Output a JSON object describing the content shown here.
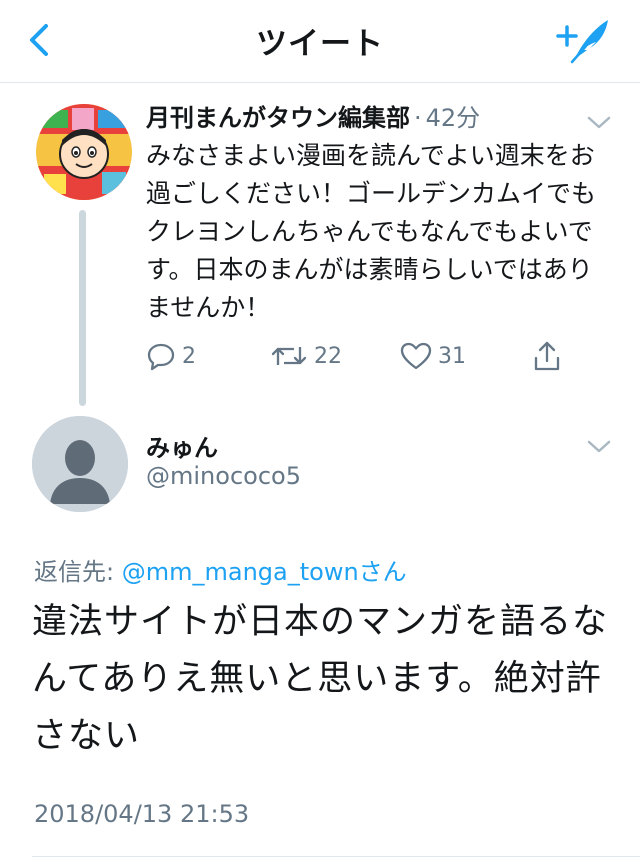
{
  "header": {
    "title": "ツイート",
    "back_icon": "chevron-left-icon",
    "compose_icon": "compose-tweet-icon",
    "accent_color": "#1da1f2"
  },
  "original_tweet": {
    "author_name": "月刊まんがタウン編集部",
    "separator": "·",
    "time_ago": "42分",
    "text": "みなさまよい漫画を読んでよい週末をお過ごしください！ゴールデンカムイでもクレヨンしんちゃんでもなんでもよいです。日本のまんがは素晴らしいではありませんか！",
    "counts": {
      "replies": "2",
      "retweets": "22",
      "likes": "31"
    },
    "icons": {
      "reply": "reply-icon",
      "retweet": "retweet-icon",
      "like": "heart-icon",
      "share": "share-icon"
    }
  },
  "reply_tweet": {
    "author_name": "みゅん",
    "handle": "@minococo5",
    "reply_to_label": "返信先:",
    "reply_to_handle": "@mm_manga_townさん",
    "text": "違法サイトが日本のマンガを語るなんてありえ無いと思います。絶対許さない",
    "timestamp": "2018/04/13 21:53"
  }
}
